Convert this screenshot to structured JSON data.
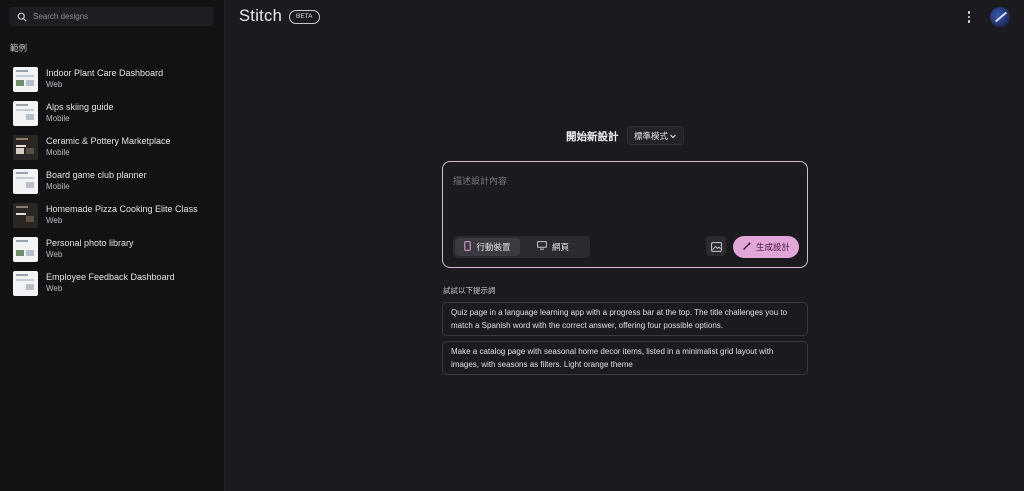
{
  "search": {
    "placeholder": "Search designs"
  },
  "sidebar": {
    "section_label": "範例",
    "projects": [
      {
        "title": "Indoor Plant Care Dashboard",
        "type": "Web"
      },
      {
        "title": "Alps skiing guide",
        "type": "Mobile"
      },
      {
        "title": "Ceramic & Pottery Marketplace",
        "type": "Mobile"
      },
      {
        "title": "Board game club planner",
        "type": "Mobile"
      },
      {
        "title": "Homemade Pizza Cooking Elite Class",
        "type": "Web"
      },
      {
        "title": "Personal photo library",
        "type": "Web"
      },
      {
        "title": "Employee Feedback Dashboard",
        "type": "Web"
      }
    ]
  },
  "header": {
    "app_name": "Stitch",
    "badge": "BETA"
  },
  "main": {
    "heading": "開始新設計",
    "mode_select": "標準模式",
    "prompt_placeholder": "描述設計內容",
    "device_mobile": "行動裝置",
    "device_web": "網頁",
    "generate_button": "生成設計",
    "suggest_label": "試試以下提示詞",
    "suggestions": [
      "Quiz page in a language learning app with a progress bar at the top. The title challenges you to match a Spanish word with the correct answer, offering four possible options.",
      "Make a catalog page with seasonal home decor items, listed in a minimalist grid layout with images, with seasons as filters. Light orange theme"
    ]
  },
  "colors": {
    "background": "#1b1b1f",
    "sidebar": "#121214",
    "accent": "#e3a6d9",
    "prompt_border": "#d9b8d4"
  },
  "icons": [
    "search-icon",
    "more-vert-icon",
    "chevron-down-icon",
    "phone-icon",
    "monitor-icon",
    "image-icon",
    "magic-wand-icon"
  ]
}
